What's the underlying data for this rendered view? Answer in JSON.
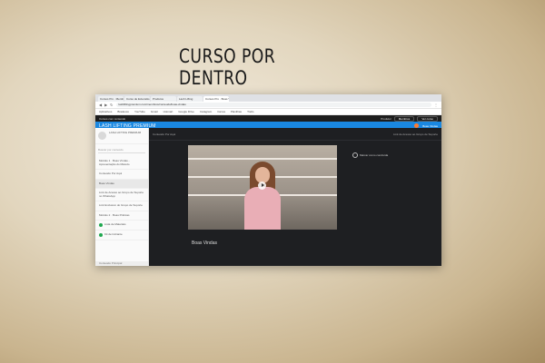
{
  "page": {
    "heading": "CURSO POR DENTRO"
  },
  "browser": {
    "tabs": [
      {
        "label": "Cursos Pro · Membros",
        "active": false
      },
      {
        "label": "Curso de Extensão",
        "active": false
      },
      {
        "label": "Produtos",
        "active": false
      },
      {
        "label": "Lash Lifting",
        "active": false
      },
      {
        "label": "Cursos Pro · Boas Vindas",
        "active": true
      }
    ],
    "url": "lashliftingpremium.com/membros/conteudo/boas-vindas"
  },
  "bookmarks": [
    "Aplicativos",
    "Bradesco",
    "YouTube",
    "Gmail",
    "Hotmart",
    "Google Drive",
    "Instagram",
    "Canva",
    "Planilhas",
    "Trello"
  ],
  "topbar": {
    "text": "Cursos com conteúdo",
    "right_label": "Produtor",
    "btn1": "Membros",
    "btn2": "Ver curso"
  },
  "course": {
    "name": "LASH LIFTING PREMIUM",
    "user": "Boas Vindas"
  },
  "sidebar": {
    "brand": "LASH LIFTING PREMIUM",
    "search_placeholder": "Buscar por conteúdo",
    "items": [
      {
        "label": "Módulo 1 · Boas Vindas - Apresentação do Método",
        "state": "normal"
      },
      {
        "label": "Conteúdo Por Aqui",
        "state": "normal"
      },
      {
        "label": "Boas Vindas",
        "state": "selected"
      },
      {
        "label": "Link de Acesso ao Grupo de Suporte no WhatsApp",
        "state": "normal"
      },
      {
        "label": "Link Exclusivo do Grupo de Suporte",
        "state": "normal"
      },
      {
        "label": "Módulo 2 · Boas Práticas",
        "state": "normal"
      },
      {
        "label": "Lista de Materiais",
        "state": "done"
      },
      {
        "label": "Kit de Iniciante",
        "state": "done"
      }
    ],
    "bottom": "Conteúdo Principal"
  },
  "content": {
    "left_label": "Conteúdo Por Aqui",
    "right_label": "Link de Acesso ao Grupo de Suporte",
    "video_title": "Boas Vindas",
    "complete_label": "Marcar como concluída"
  }
}
